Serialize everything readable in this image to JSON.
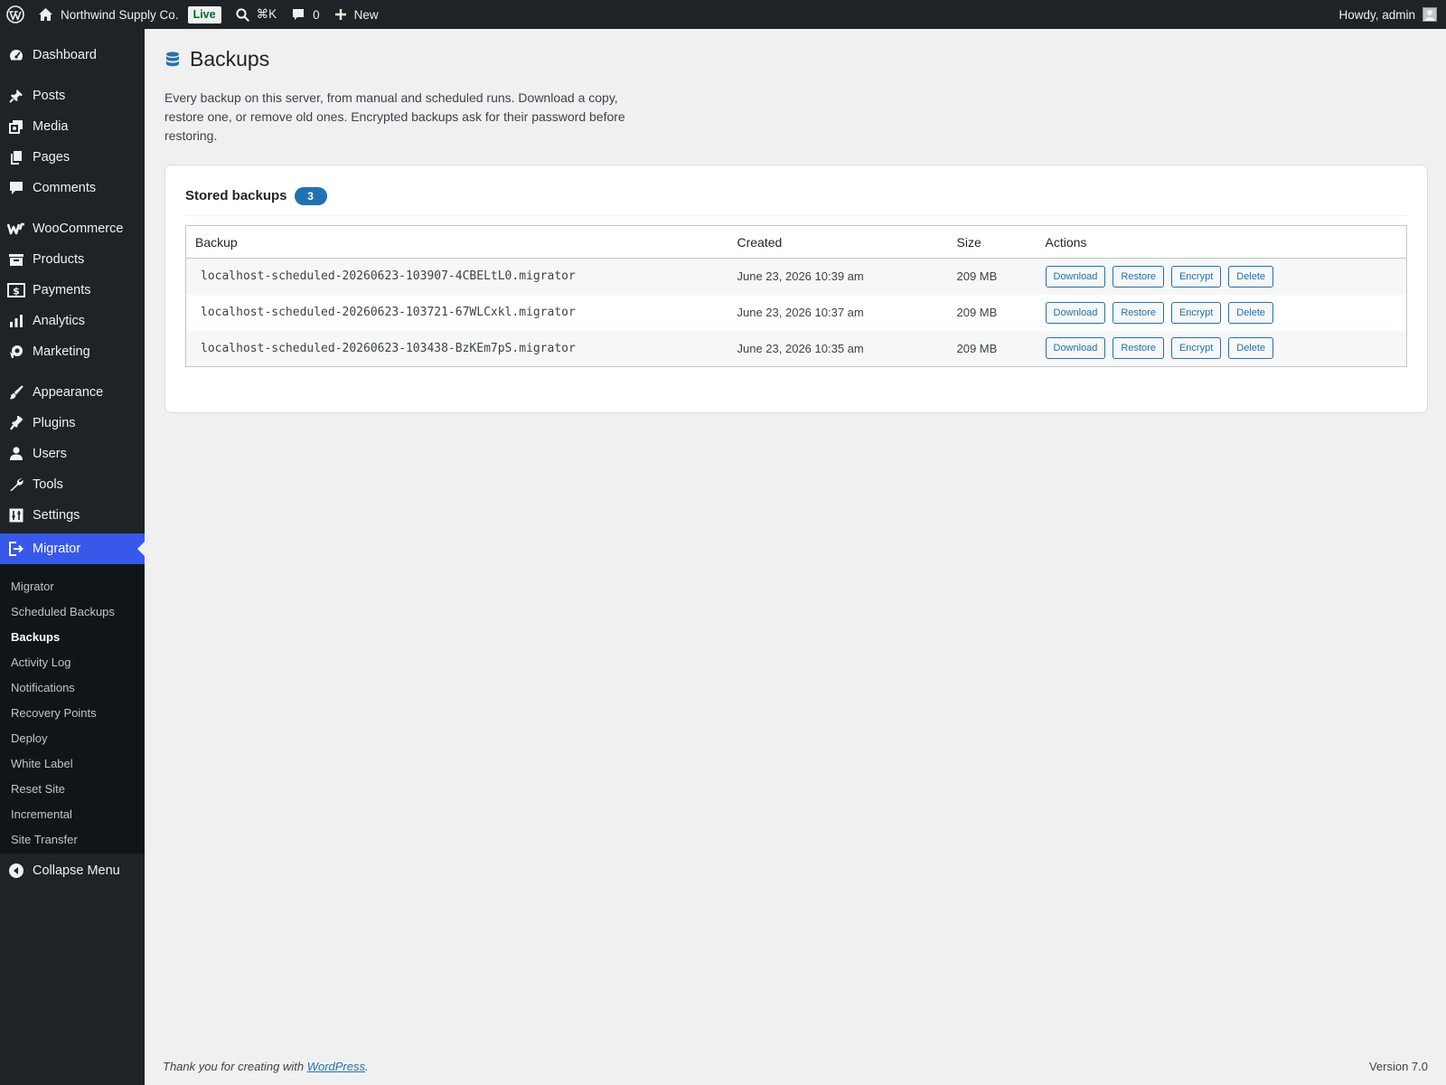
{
  "adminbar": {
    "site_name": "Northwind Supply Co.",
    "live_badge": "Live",
    "search_shortcut": "⌘K",
    "comments_count": "0",
    "new_label": "New",
    "howdy": "Howdy, admin"
  },
  "sidebar": {
    "items": [
      {
        "label": "Dashboard",
        "icon": "dashboard-icon"
      },
      {
        "label": "Posts",
        "icon": "pin-icon"
      },
      {
        "label": "Media",
        "icon": "media-icon"
      },
      {
        "label": "Pages",
        "icon": "pages-icon"
      },
      {
        "label": "Comments",
        "icon": "comment-icon"
      },
      {
        "label": "WooCommerce",
        "icon": "woocommerce-icon"
      },
      {
        "label": "Products",
        "icon": "archive-icon"
      },
      {
        "label": "Payments",
        "icon": "dollar-icon"
      },
      {
        "label": "Analytics",
        "icon": "bar-chart-icon"
      },
      {
        "label": "Marketing",
        "icon": "megaphone-icon"
      },
      {
        "label": "Appearance",
        "icon": "brush-icon"
      },
      {
        "label": "Plugins",
        "icon": "plug-icon"
      },
      {
        "label": "Users",
        "icon": "user-icon"
      },
      {
        "label": "Tools",
        "icon": "wrench-icon"
      },
      {
        "label": "Settings",
        "icon": "sliders-icon"
      },
      {
        "label": "Migrator",
        "icon": "migrate-icon",
        "current": true
      }
    ],
    "submenu": [
      {
        "label": "Migrator"
      },
      {
        "label": "Scheduled Backups"
      },
      {
        "label": "Backups",
        "current": true
      },
      {
        "label": "Activity Log"
      },
      {
        "label": "Notifications"
      },
      {
        "label": "Recovery Points"
      },
      {
        "label": "Deploy"
      },
      {
        "label": "White Label"
      },
      {
        "label": "Reset Site"
      },
      {
        "label": "Incremental"
      },
      {
        "label": "Site Transfer"
      }
    ],
    "collapse_label": "Collapse Menu"
  },
  "page": {
    "title": "Backups",
    "description": "Every backup on this server, from manual and scheduled runs. Download a copy, restore one, or remove old ones. Encrypted backups ask for their password before restoring."
  },
  "card": {
    "title": "Stored backups",
    "count": "3",
    "columns": [
      "Backup",
      "Created",
      "Size",
      "Actions"
    ],
    "action_labels": [
      "Download",
      "Restore",
      "Encrypt",
      "Delete"
    ],
    "rows": [
      {
        "file": "localhost-scheduled-20260623-103907-4CBELtL0.migrator",
        "created": "June 23, 2026 10:39 am",
        "size": "209 MB"
      },
      {
        "file": "localhost-scheduled-20260623-103721-67WLCxkl.migrator",
        "created": "June 23, 2026 10:37 am",
        "size": "209 MB"
      },
      {
        "file": "localhost-scheduled-20260623-103438-BzKEm7pS.migrator",
        "created": "June 23, 2026 10:35 am",
        "size": "209 MB"
      }
    ]
  },
  "footer": {
    "thanks_prefix": "Thank you for creating with ",
    "thanks_link": "WordPress",
    "thanks_suffix": ".",
    "version": "Version 7.0"
  },
  "colors": {
    "adminbar_bg": "#1d2327",
    "menu_current": "#3858e9",
    "link": "#2271b1",
    "live_badge_text": "#00692e"
  }
}
